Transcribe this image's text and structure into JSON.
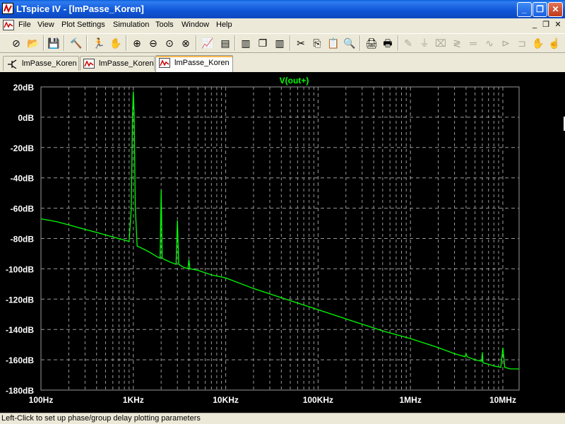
{
  "window": {
    "title": "LTspice IV - [lmPasse_Koren]"
  },
  "menu": [
    "File",
    "View",
    "Plot Settings",
    "Simulation",
    "Tools",
    "Window",
    "Help"
  ],
  "toolbar": [
    {
      "icon": "new-schematic-icon",
      "glyph": "⊘"
    },
    {
      "icon": "open-icon",
      "glyph": "📂"
    },
    {
      "icon": "save-icon",
      "glyph": "💾"
    },
    {
      "icon": "control-panel-icon",
      "glyph": "🔨"
    },
    {
      "icon": "run-icon",
      "glyph": "🏃"
    },
    {
      "icon": "halt-icon",
      "glyph": "✋"
    },
    {
      "icon": "zoom-in-icon",
      "glyph": "⊕"
    },
    {
      "icon": "zoom-out-icon",
      "glyph": "⊖"
    },
    {
      "icon": "zoom-fit-icon",
      "glyph": "⊙"
    },
    {
      "icon": "zoom-cancel-icon",
      "glyph": "⊗"
    },
    {
      "icon": "autorange-icon",
      "glyph": "📈"
    },
    {
      "icon": "tile-horizontal-icon",
      "glyph": "▤"
    },
    {
      "icon": "cascade-icon",
      "glyph": "❐"
    },
    {
      "icon": "tile-vertical-icon",
      "glyph": "▥"
    },
    {
      "icon": "cut-icon",
      "glyph": "✂"
    },
    {
      "icon": "copy-icon",
      "glyph": "⎘"
    },
    {
      "icon": "paste-icon",
      "glyph": "📋"
    },
    {
      "icon": "find-icon",
      "glyph": "🔍"
    },
    {
      "icon": "print-preview-icon",
      "glyph": "🖨"
    },
    {
      "icon": "print-icon",
      "glyph": "🖶"
    },
    {
      "icon": "wire-icon",
      "glyph": "✎"
    },
    {
      "icon": "ground-icon",
      "glyph": "⏚"
    },
    {
      "icon": "label-icon",
      "glyph": "⌧"
    },
    {
      "icon": "resistor-icon",
      "glyph": "≷"
    },
    {
      "icon": "capacitor-icon",
      "glyph": "═"
    },
    {
      "icon": "inductor-icon",
      "glyph": "∿"
    },
    {
      "icon": "diode-icon",
      "glyph": "⊳"
    },
    {
      "icon": "component-icon",
      "glyph": "⊐"
    },
    {
      "icon": "move-icon",
      "glyph": "✋"
    },
    {
      "icon": "drag-icon",
      "glyph": "☝"
    }
  ],
  "tabs": [
    {
      "label": "lmPasse_Koren",
      "icon": "schematic-icon"
    },
    {
      "label": "lmPasse_Koren",
      "icon": "waveform-icon"
    },
    {
      "label": "lmPasse_Koren",
      "icon": "waveform-icon"
    }
  ],
  "active_tab": 2,
  "colors": {
    "trace": "#00ff00",
    "grid": "#999999",
    "axis_text": "#ffffff",
    "plot_bg": "#000000"
  },
  "chart_data": {
    "type": "line",
    "title": "V(out+)",
    "x_scale": "log",
    "xlim": [
      100,
      15000000
    ],
    "ylim": [
      -180,
      20
    ],
    "x_ticks": [
      {
        "value": 100,
        "label": "100Hz"
      },
      {
        "value": 1000,
        "label": "1KHz"
      },
      {
        "value": 10000,
        "label": "10KHz"
      },
      {
        "value": 100000,
        "label": "100KHz"
      },
      {
        "value": 1000000,
        "label": "1MHz"
      },
      {
        "value": 10000000,
        "label": "10MHz"
      }
    ],
    "y_ticks": [
      {
        "value": 20,
        "label": "20dB"
      },
      {
        "value": 0,
        "label": "0dB"
      },
      {
        "value": -20,
        "label": "-20dB"
      },
      {
        "value": -40,
        "label": "-40dB"
      },
      {
        "value": -60,
        "label": "-60dB"
      },
      {
        "value": -80,
        "label": "-80dB"
      },
      {
        "value": -100,
        "label": "-100dB"
      },
      {
        "value": -120,
        "label": "-120dB"
      },
      {
        "value": -140,
        "label": "-140dB"
      },
      {
        "value": -160,
        "label": "-160dB"
      },
      {
        "value": -180,
        "label": "-180dB"
      }
    ],
    "grid": true,
    "series": [
      {
        "name": "V(out+)",
        "x": [
          100,
          150,
          200,
          300,
          400,
          600,
          800,
          900,
          950,
          980,
          1000,
          1020,
          1050,
          1100,
          1200,
          1500,
          1800,
          1950,
          2000,
          2050,
          2200,
          2600,
          2900,
          3000,
          3100,
          3500,
          3900,
          4000,
          4100,
          5000,
          7000,
          10000,
          20000,
          50000,
          100000,
          200000,
          500000,
          1000000,
          2000000,
          3000000,
          3900000,
          4000000,
          4100000,
          5000000,
          5900000,
          6000000,
          6100000,
          7000000,
          8000000,
          9500000,
          10000000,
          10500000,
          12000000,
          15000000
        ],
        "y": [
          -67,
          -69,
          -71,
          -74,
          -76,
          -79,
          -81,
          -82,
          -60,
          2,
          17,
          3,
          -60,
          -85,
          -86,
          -89,
          -92,
          -93,
          -48,
          -93,
          -94,
          -96,
          -97,
          -68,
          -97,
          -99,
          -100,
          -94,
          -100,
          -101,
          -104,
          -106,
          -113,
          -121,
          -127,
          -133,
          -141,
          -146,
          -152,
          -156,
          -158,
          -156,
          -158,
          -160,
          -161,
          -155,
          -162,
          -163,
          -164,
          -165,
          -152,
          -165,
          -166,
          -166
        ]
      }
    ]
  },
  "status": {
    "text": "Left-Click to set up phase/group delay plotting parameters"
  }
}
